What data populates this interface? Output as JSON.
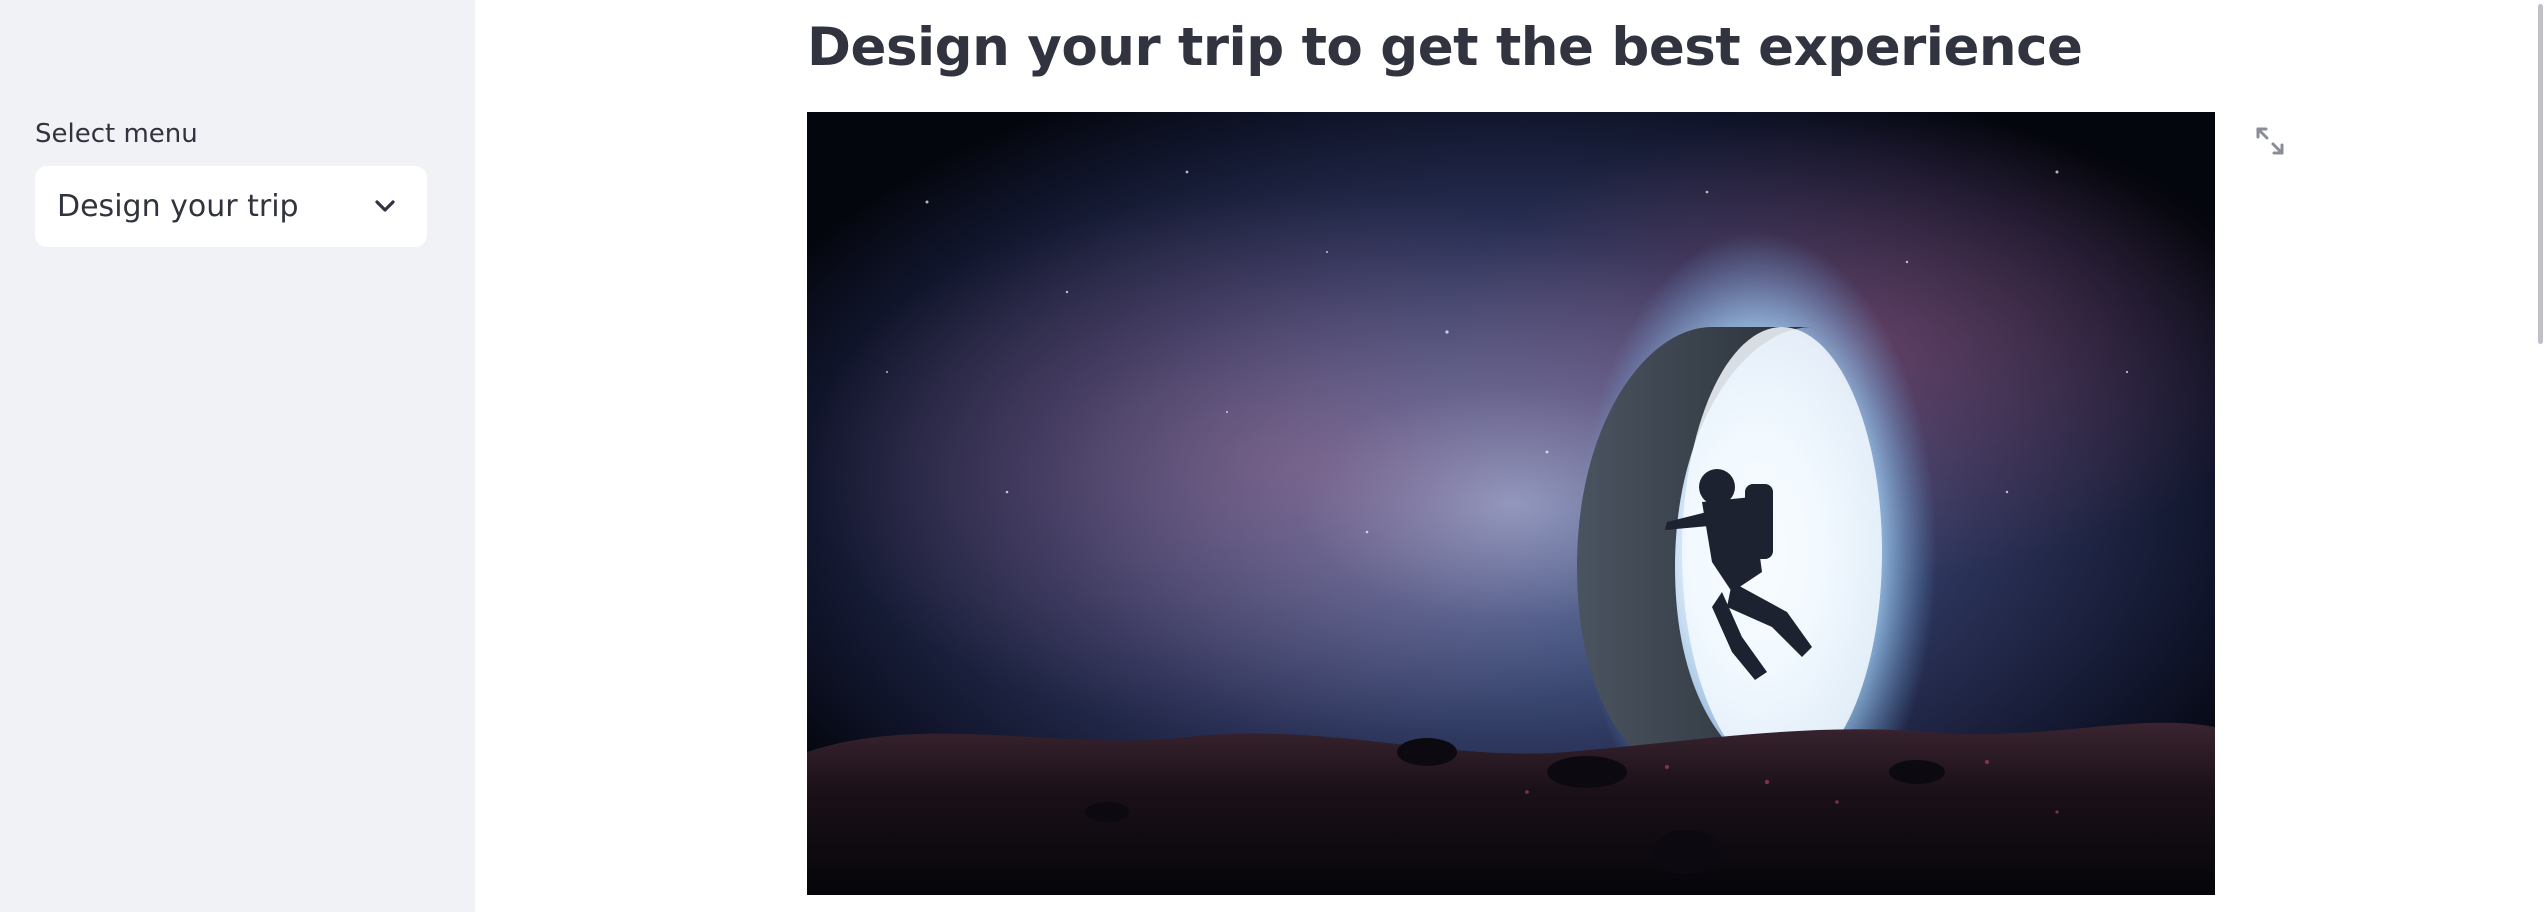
{
  "sidebar": {
    "select_label": "Select menu",
    "selected_option": "Design your trip",
    "dropdown_icon": "chevron-down-icon"
  },
  "main": {
    "title": "Design your trip to get the best experience",
    "image": {
      "subject": "astronaut-floating-toward-glowing-ring-portal-in-space",
      "fullscreen_icon": "expand-icon"
    }
  },
  "colors": {
    "sidebar_bg": "#f0f2f6",
    "text": "#31333f",
    "page_bg": "#ffffff"
  }
}
